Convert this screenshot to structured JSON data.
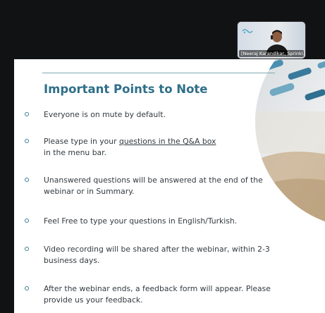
{
  "video": {
    "participant_name": "[Neeraj Karandikar, Sprinkl..."
  },
  "slide": {
    "title": "Important Points to Note",
    "bullets": [
      {
        "text": "Everyone is on mute by default."
      },
      {
        "before": "Please type in your ",
        "link": "questions in the Q&A box",
        "after": "",
        "line2": "in the menu bar."
      },
      {
        "text": "Unanswered questions will be answered at the end of the webinar or in Summary."
      },
      {
        "text": "Feel Free to type your questions in English/Turkish."
      },
      {
        "text": "Video recording will be shared after the webinar, within 2-3 business days."
      },
      {
        "text": "After the webinar ends, a feedback form will appear. Please provide us your feedback."
      }
    ],
    "colors": {
      "title": "#2f6f89",
      "bullet": "#3b7f95",
      "text": "#333a40"
    }
  }
}
